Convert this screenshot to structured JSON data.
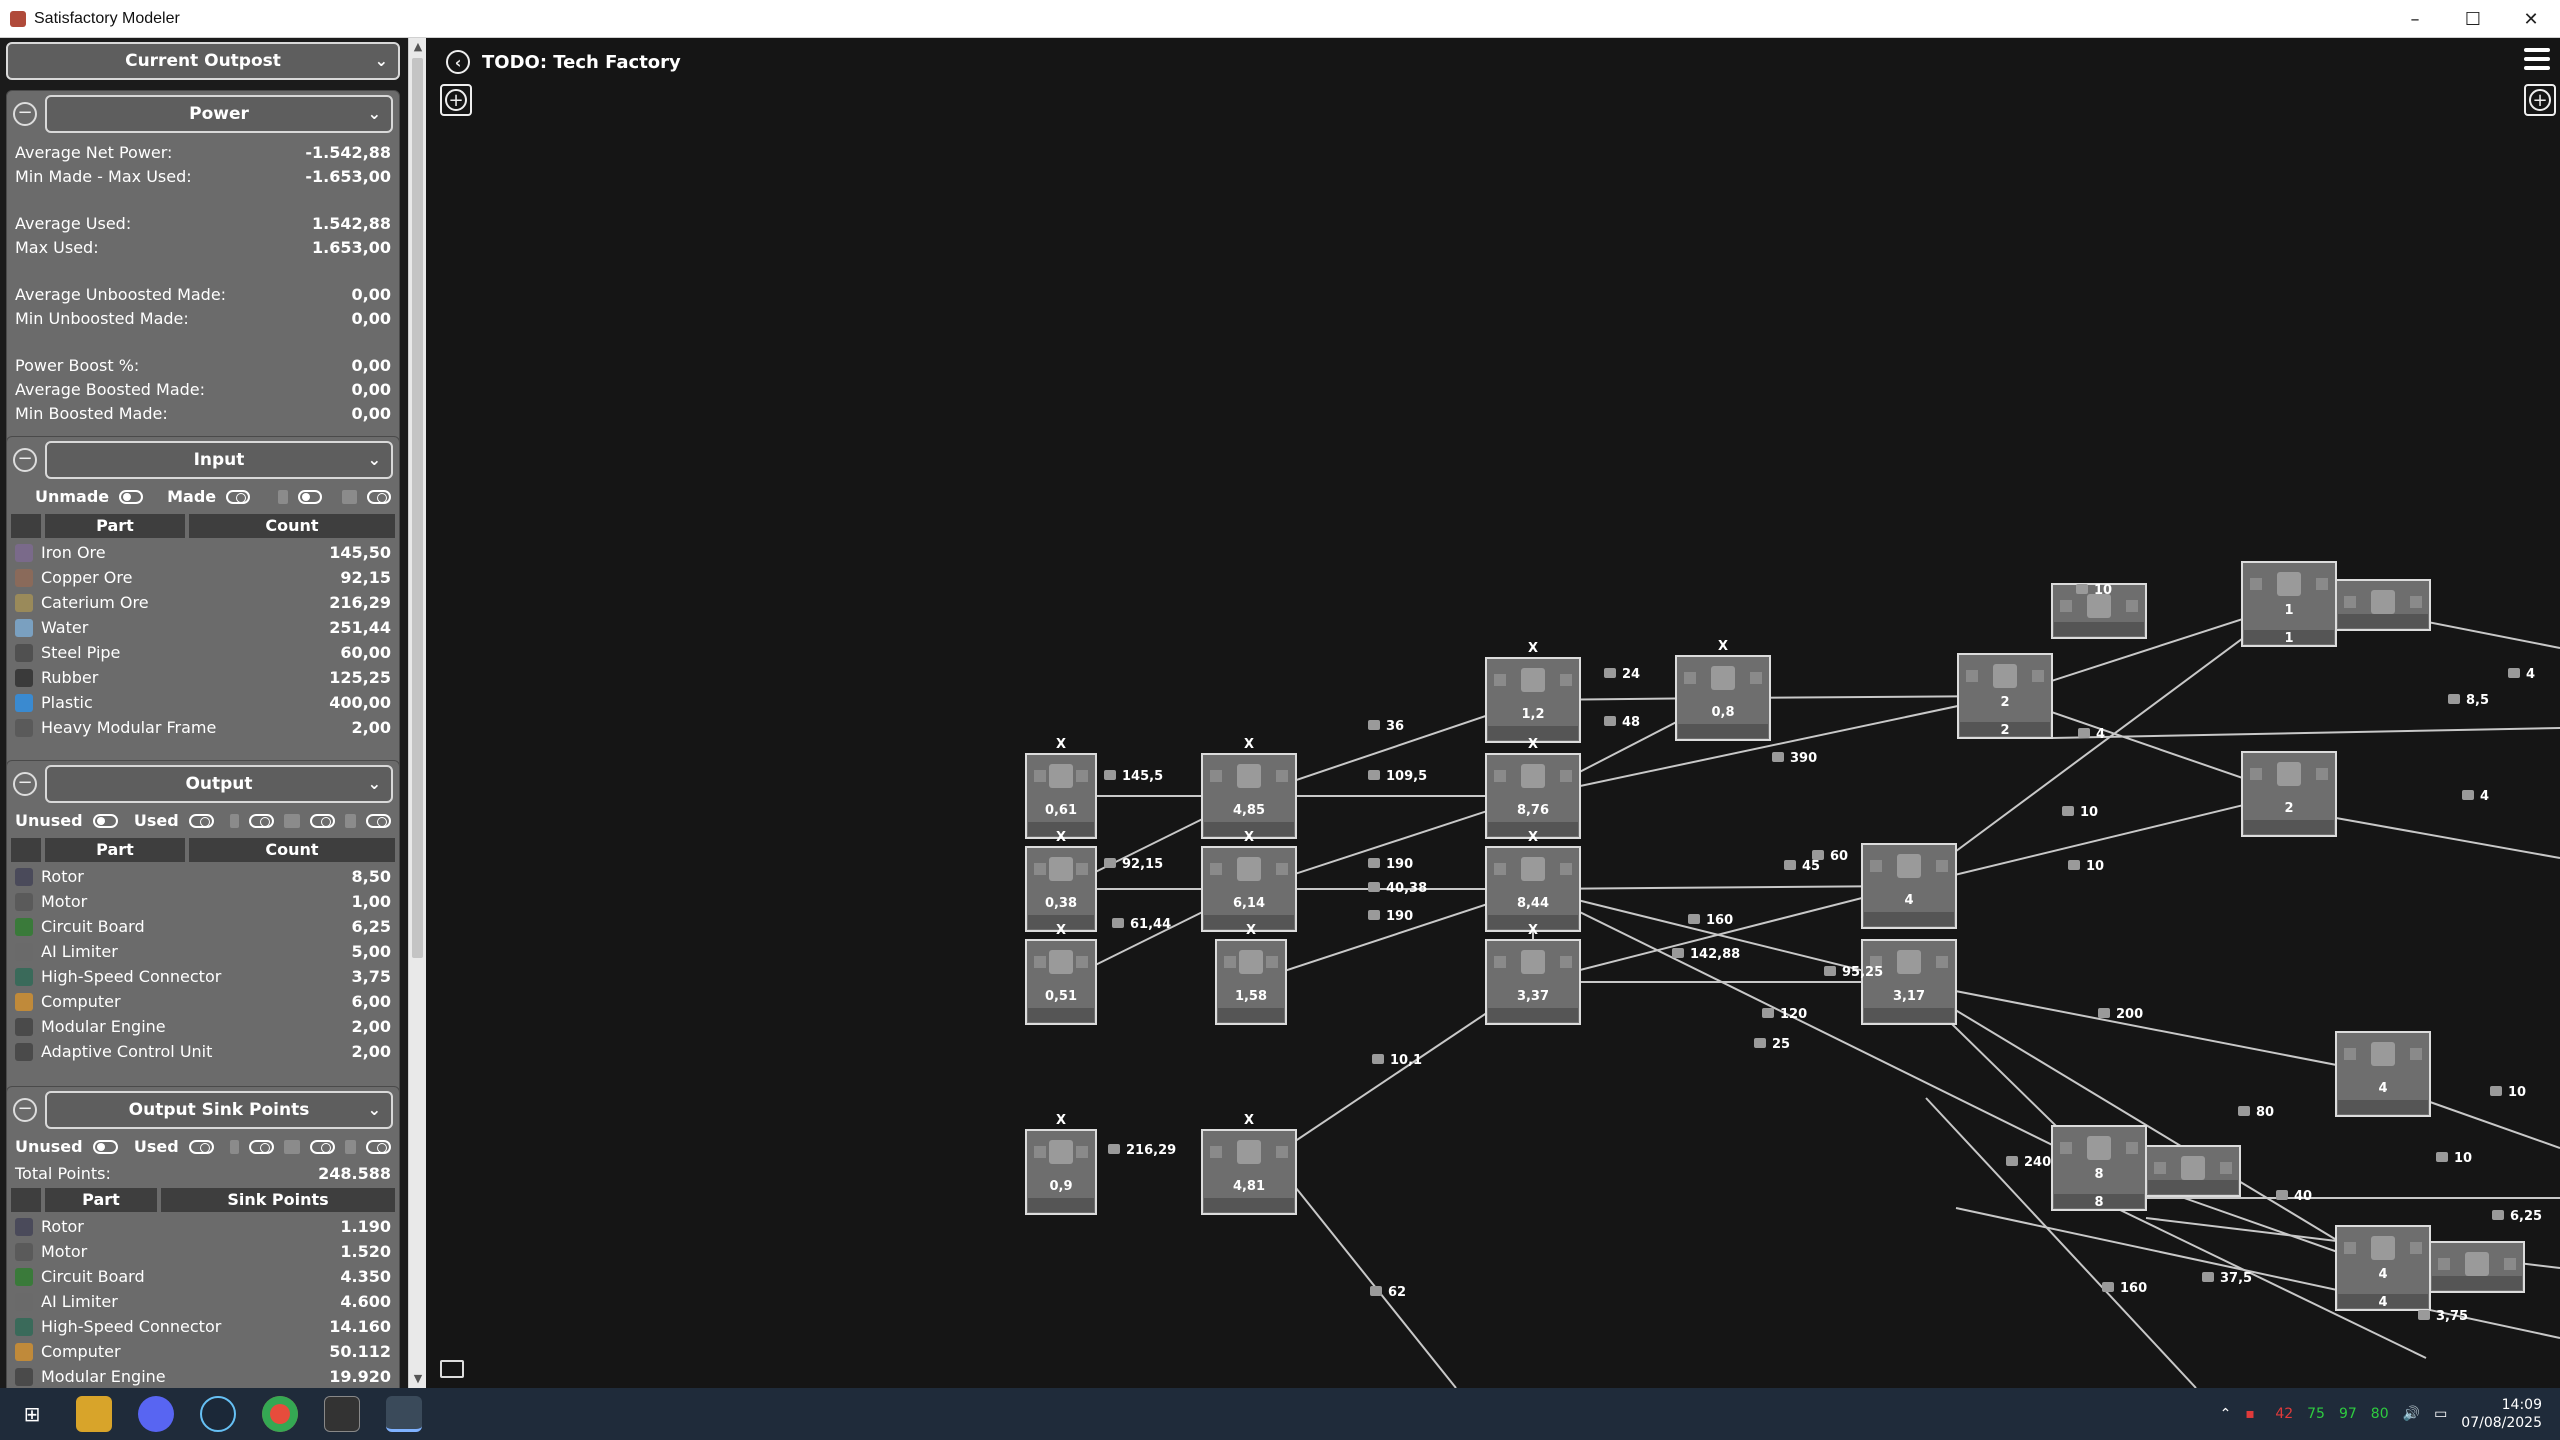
{
  "window": {
    "title": "Satisfactory Modeler",
    "minimize": "–",
    "maximize": "☐",
    "close": "✕"
  },
  "outpost_select": "Current Outpost",
  "power": {
    "header": "Power",
    "rows1": [
      {
        "k": "Average Net Power:",
        "v": "-1.542,88"
      },
      {
        "k": "Min Made - Max Used:",
        "v": "-1.653,00"
      }
    ],
    "rows2": [
      {
        "k": "Average Used:",
        "v": "1.542,88"
      },
      {
        "k": "Max Used:",
        "v": "1.653,00"
      }
    ],
    "rows3": [
      {
        "k": "Average Unboosted Made:",
        "v": "0,00"
      },
      {
        "k": "Min Unboosted Made:",
        "v": "0,00"
      }
    ],
    "rows4": [
      {
        "k": "Power Boost %:",
        "v": "0,00"
      },
      {
        "k": "Average Boosted Made:",
        "v": "0,00"
      },
      {
        "k": "Min Boosted Made:",
        "v": "0,00"
      }
    ]
  },
  "input": {
    "header": "Input",
    "toggle1": "Unmade",
    "toggle2": "Made",
    "col_part": "Part",
    "col_count": "Count",
    "rows": [
      {
        "name": "Iron Ore",
        "value": "145,50",
        "color": "#7a6a8a"
      },
      {
        "name": "Copper Ore",
        "value": "92,15",
        "color": "#8a6a5a"
      },
      {
        "name": "Caterium Ore",
        "value": "216,29",
        "color": "#9a8a5a"
      },
      {
        "name": "Water",
        "value": "251,44",
        "color": "#7aa0c0"
      },
      {
        "name": "Steel Pipe",
        "value": "60,00",
        "color": "#505050"
      },
      {
        "name": "Rubber",
        "value": "125,25",
        "color": "#3a3a3a"
      },
      {
        "name": "Plastic",
        "value": "400,00",
        "color": "#3a8ad0"
      },
      {
        "name": "Heavy Modular Frame",
        "value": "2,00",
        "color": "#5a5a5a"
      }
    ]
  },
  "output": {
    "header": "Output",
    "toggle1": "Unused",
    "toggle2": "Used",
    "col_part": "Part",
    "col_count": "Count",
    "rows": [
      {
        "name": "Rotor",
        "value": "8,50",
        "color": "#4a4a5a"
      },
      {
        "name": "Motor",
        "value": "1,00",
        "color": "#5a5a5a"
      },
      {
        "name": "Circuit Board",
        "value": "6,25",
        "color": "#3a7a3a"
      },
      {
        "name": "AI Limiter",
        "value": "5,00",
        "color": "#6a6a6a"
      },
      {
        "name": "High-Speed Connector",
        "value": "3,75",
        "color": "#3a6a5a"
      },
      {
        "name": "Computer",
        "value": "6,00",
        "color": "#c08a3a"
      },
      {
        "name": "Modular Engine",
        "value": "2,00",
        "color": "#4a4a4a"
      },
      {
        "name": "Adaptive Control Unit",
        "value": "2,00",
        "color": "#4a4a4a"
      }
    ]
  },
  "sink": {
    "header": "Output Sink Points",
    "toggle1": "Unused",
    "toggle2": "Used",
    "total_label": "Total Points:",
    "total_value": "248.588",
    "col_part": "Part",
    "col_points": "Sink Points",
    "rows": [
      {
        "name": "Rotor",
        "value": "1.190",
        "color": "#4a4a5a"
      },
      {
        "name": "Motor",
        "value": "1.520",
        "color": "#5a5a5a"
      },
      {
        "name": "Circuit Board",
        "value": "4.350",
        "color": "#3a7a3a"
      },
      {
        "name": "AI Limiter",
        "value": "4.600",
        "color": "#6a6a6a"
      },
      {
        "name": "High-Speed Connector",
        "value": "14.160",
        "color": "#3a6a5a"
      },
      {
        "name": "Computer",
        "value": "50.112",
        "color": "#c08a3a"
      },
      {
        "name": "Modular Engine",
        "value": "19.920",
        "color": "#4a4a4a"
      }
    ]
  },
  "canvas": {
    "title": "TODO: Tech Factory"
  },
  "graph": {
    "nodes": [
      {
        "id": "n1",
        "label": "0,61",
        "mark": "X"
      },
      {
        "id": "n2",
        "label": "0,38",
        "mark": "X"
      },
      {
        "id": "n3",
        "label": "0,51",
        "mark": "X"
      },
      {
        "id": "n4",
        "label": "0,9",
        "mark": "X"
      },
      {
        "id": "n5",
        "label": "4,85",
        "mark": "X"
      },
      {
        "id": "n6",
        "label": "6,14",
        "mark": "X"
      },
      {
        "id": "n7",
        "label": "1,58",
        "mark": "X"
      },
      {
        "id": "n8",
        "label": "4,81",
        "mark": "X"
      },
      {
        "id": "n9",
        "label": "1,2",
        "mark": "X"
      },
      {
        "id": "n10",
        "label": "8,76",
        "mark": "X"
      },
      {
        "id": "n11",
        "label": "8,44",
        "mark": "X"
      },
      {
        "id": "n12",
        "label": "3,37",
        "mark": "X"
      },
      {
        "id": "n13",
        "label": "0,8",
        "mark": "X"
      },
      {
        "id": "n14",
        "label": "4",
        "mark": ""
      },
      {
        "id": "n15",
        "label": "3,17",
        "mark": ""
      },
      {
        "id": "n16",
        "label": "2",
        "label2": "2",
        "mark": ""
      },
      {
        "id": "n17",
        "label": "1",
        "label2": "1",
        "mark": ""
      },
      {
        "id": "n18",
        "label": "2",
        "mark": ""
      },
      {
        "id": "n19",
        "label": "4",
        "mark": ""
      },
      {
        "id": "n20",
        "label": "8",
        "label2": "8",
        "mark": ""
      },
      {
        "id": "n21",
        "label": "4",
        "label2": "4",
        "mark": ""
      }
    ],
    "edge_labels": [
      "145,5",
      "92,15",
      "61,44",
      "216,29",
      "36",
      "109,5",
      "190",
      "40,38",
      "190",
      "10,1",
      "62",
      "24",
      "48",
      "390",
      "45",
      "60",
      "160",
      "142,88",
      "95,25",
      "120",
      "25",
      "10",
      "10",
      "10",
      "4",
      "8,5",
      "4",
      "200",
      "80",
      "240",
      "40",
      "37,5",
      "160",
      "10",
      "6,25",
      "3,75",
      "4",
      "10"
    ]
  },
  "taskbar": {
    "tray_nums": [
      "42",
      "75",
      "97",
      "80"
    ],
    "time": "14:09",
    "date": "07/08/2025"
  }
}
